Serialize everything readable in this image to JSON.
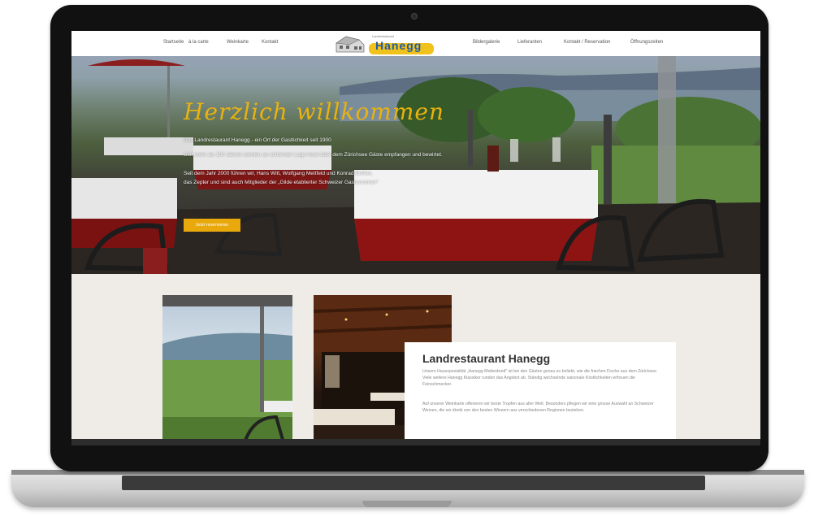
{
  "nav": {
    "left_links": [
      "Startseite",
      "à la carte",
      "Weinkarte",
      "Kontakt"
    ],
    "right_links": [
      "Bildergalerie",
      "Lieferanten",
      "Kontakt / Reservation",
      "Öffnungszeiten"
    ]
  },
  "logo": {
    "small_text": "Landrestaurant",
    "name": "Hanegg"
  },
  "hero": {
    "title": "Herzlich willkommen",
    "line1": "Das Landrestaurant Hanegg - ein Ort der Gastlichkeit seit 1900",
    "line2": "Seit mehr als 100 Jahren werden an schönster Lage hoch über dem Zürichsee Gäste empfangen und bewirtet.",
    "line3": "Seit dem Jahr 2000 führen wir, Hans Witt, Wolfgang Mettfeld und Konrad Dreher,",
    "line4": "das Zepter und sind auch Mitglieder der „Gilde etablierter Schweizer Gastronomen\"",
    "button": "Jetzt reservieren"
  },
  "about": {
    "title": "Landrestaurant Hanegg",
    "paragraph1": "Unsere Hausspezialität „Hanegg Mettenbrett\" ist bei den Gästen genau so beliebt, wie die frischen Fische aus dem Zürichsee. Viele weitere Hanegg Klassiker runden das Angebot ab. Ständig wechselnde saisonale Köstlichkeiten erfreuen die Feinschmecker.",
    "paragraph2": "Auf unserer Weinkarte offerieren wir beste Tropfen aus aller Welt. Besonders pflegen wir eine grosse Auswahl an Schweizer Weinen, die wir direkt von den besten Winzern aus verschiedenen Regionen beziehen."
  },
  "colors": {
    "accent": "#e9a90d",
    "title_gold": "#e9b20e",
    "logo_blue": "#1d5aa8",
    "logo_yellow": "#f0c21b"
  }
}
